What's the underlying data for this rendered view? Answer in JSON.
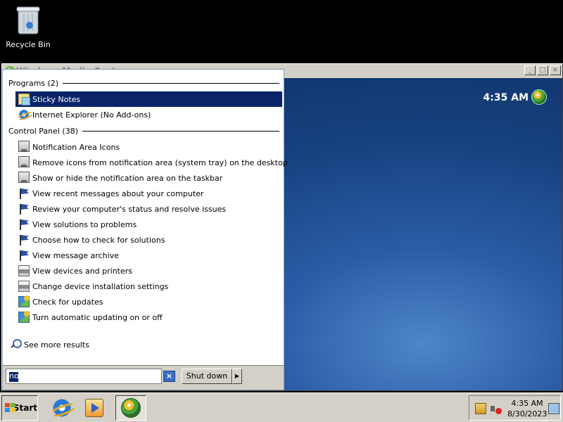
{
  "desktop": {
    "recycle_bin_label": "Recycle Bin"
  },
  "background_window": {
    "title": "Windows Media Center",
    "clock": "4:35 AM",
    "buttons": {
      "minimize": "_",
      "maximize": "□",
      "close": "×"
    }
  },
  "search_results": {
    "programs_header": "Programs (2)",
    "programs": [
      {
        "label": "Sticky Notes",
        "icon": "sticky-notes-icon",
        "selected": true
      },
      {
        "label": "Internet Explorer (No Add-ons)",
        "icon": "internet-explorer-icon",
        "selected": false
      }
    ],
    "control_panel_header": "Control Panel (38)",
    "control_panel": [
      {
        "label": "Notification Area Icons",
        "icon": "notification-area-icon"
      },
      {
        "label": "Remove icons from notification area (system tray) on the desktop",
        "icon": "notification-area-icon"
      },
      {
        "label": "Show or hide the notification area on the taskbar",
        "icon": "notification-area-icon"
      },
      {
        "label": "View recent messages about your computer",
        "icon": "action-center-flag-icon"
      },
      {
        "label": "Review your computer's status and resolve issues",
        "icon": "action-center-flag-icon"
      },
      {
        "label": "View solutions to problems",
        "icon": "action-center-flag-icon"
      },
      {
        "label": "Choose how to check for solutions",
        "icon": "action-center-flag-icon"
      },
      {
        "label": "View message archive",
        "icon": "action-center-flag-icon"
      },
      {
        "label": "View devices and printers",
        "icon": "devices-printers-icon"
      },
      {
        "label": "Change device installation settings",
        "icon": "devices-printers-icon"
      },
      {
        "label": "Check for updates",
        "icon": "windows-update-icon"
      },
      {
        "label": "Turn automatic updating on or off",
        "icon": "windows-update-icon"
      }
    ],
    "see_more": "See more results"
  },
  "search": {
    "query": "no",
    "clear_label": "×"
  },
  "shutdown": {
    "label": "Shut down",
    "arrow": "▶"
  },
  "taskbar": {
    "start_label": "Start",
    "quick_launch": [
      "internet-explorer-icon",
      "windows-media-player-icon",
      "windows-media-center-icon"
    ],
    "tray": {
      "time": "4:35 AM",
      "date": "8/30/2023"
    }
  }
}
